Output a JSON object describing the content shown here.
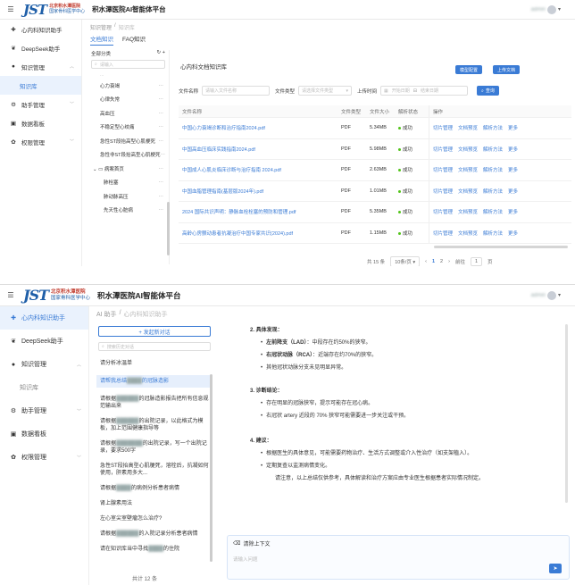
{
  "app": {
    "title": "积水潭医院AI智能体平台",
    "logo_mark": "JST",
    "logo_line1": "北京积水潭医院",
    "logo_line2": "国家骨科医学中心",
    "user": "admin"
  },
  "nav": {
    "cardio": "心内科知识助手",
    "deepseek": "DeepSeek助手",
    "knowledge": "知识管理",
    "knowledge_base": "知识库",
    "assistant_mgmt": "助手管理",
    "dashboard": "数据看板",
    "permissions": "权限管理"
  },
  "s1": {
    "breadcrumb": [
      "知识管理",
      "/",
      "知识库"
    ],
    "tabs": [
      "文档知识",
      "FAQ知识"
    ],
    "tree": {
      "header": "全部分类",
      "search_placeholder": "请输入",
      "items": [
        {
          "label": "心力衰竭",
          "type": "child"
        },
        {
          "label": "心律失常",
          "type": "child"
        },
        {
          "label": "高血压",
          "type": "child"
        },
        {
          "label": "不稳定型心绞痛",
          "type": "child"
        },
        {
          "label": "急性ST段抬高型心肌梗死",
          "type": "child"
        },
        {
          "label": "急性非ST段抬高型心肌梗死",
          "type": "child"
        },
        {
          "label": "病案首页",
          "type": "group"
        },
        {
          "label": "肺栓塞",
          "type": "child2"
        },
        {
          "label": "肺动脉高压",
          "type": "child2"
        },
        {
          "label": "先天性心脏病",
          "type": "child2"
        }
      ]
    },
    "main": {
      "title": "心内科文档知识库",
      "btn_config": "模型配置",
      "btn_upload": "上传文档",
      "filter_name_label": "文件名称",
      "filter_name_placeholder": "请输入文件名称",
      "filter_type_label": "文件类型",
      "filter_type_placeholder": "请选择文件类型",
      "filter_time_label": "上传时间",
      "filter_start": "开始日期",
      "filter_end": "结束日期",
      "btn_search": "查询",
      "columns": [
        "文件名称",
        "文件类型",
        "文件大小",
        "解析状态",
        "操作"
      ],
      "rows": [
        {
          "name": "中国心力衰竭诊断和治疗指南2024.pdf",
          "type": "PDF",
          "size": "5.34MB",
          "status": "成功"
        },
        {
          "name": "中国高血压临床实践指南2024.pdf",
          "type": "PDF",
          "size": "5.98MB",
          "status": "成功"
        },
        {
          "name": "中国成人心肌炎临床诊断与治疗指南 2024.pdf",
          "type": "PDF",
          "size": "2.63MB",
          "status": "成功"
        },
        {
          "name": "中国血脂管理指南(基层版2024年).pdf",
          "type": "PDF",
          "size": "1.01MB",
          "status": "成功"
        },
        {
          "name": "2024 国际共识声明：静脉血栓栓塞的预防和管理.pdf",
          "type": "PDF",
          "size": "5.35MB",
          "status": "成功"
        },
        {
          "name": "高龄心房颤动患者抗凝治疗中国专家共识(2024).pdf",
          "type": "PDF",
          "size": "1.15MB",
          "status": "成功"
        }
      ],
      "actions": [
        "切片管理",
        "文档预览",
        "解析方法",
        "更多"
      ],
      "pager": {
        "total": "共 15 条",
        "size": "10条/页",
        "p1": "1",
        "p2": "2",
        "goto": "前往",
        "goto_val": "1",
        "unit": "页"
      }
    }
  },
  "s2": {
    "breadcrumb": [
      "AI 助手",
      "/",
      "心内科知识助手"
    ],
    "new_chat": "+ 发起新对话",
    "search_placeholder": "搜索历史对话",
    "conversations": [
      {
        "text": "请分析冰温单",
        "sel": false
      },
      {
        "text": "请帮我总结████的冠脉造影",
        "sel": true
      },
      {
        "text": "请根据██████的冠脉造影报告把所有信息规范输出来",
        "sel": false
      },
      {
        "text": "请根据██████的出院记录，以此格式为模板，加上范围健康指导等",
        "sel": false
      },
      {
        "text": "请根据███████的出院记录，写一个出院记录，要求500字",
        "sel": false
      },
      {
        "text": "急性ST段抬高型心肌梗死，溶栓后，抗凝如何使用，肝素用多大...",
        "sel": false
      },
      {
        "text": "请根据████的病例分析患者病情",
        "sel": false
      },
      {
        "text": "肾上腺素用法",
        "sel": false
      },
      {
        "text": "左心室尖室壁瘤怎么治疗?",
        "sel": false
      },
      {
        "text": "请根据██████的入院记录分析患者病情",
        "sel": false
      },
      {
        "text": "请在知识库当中寻找████的住院",
        "sel": false
      }
    ],
    "total": "共计 12 条",
    "answer": {
      "sec2": "2. 具体发现：",
      "f1_bold": "左前降支（LAD）",
      "f1": "：中段存在约50%的狭窄。",
      "f2_bold": "右冠状动脉（RCA）",
      "f2": "：近端存在约70%的狭窄。",
      "f3": "其他冠状动脉分支未见明显异常。",
      "sec3": "3. 诊断结论：",
      "d1": "存在明显的冠脉狭窄，提示可能存在冠心病。",
      "d2": "右冠状 artery 近段的 70% 狭窄可能需要进一步关注或干预。",
      "sec4": "4. 建议：",
      "r1": "根据医生的具体意见，可能需要药物治疗、生活方式调整或介入性治疗（如支架植入）。",
      "r2": "定期复查以监测病情变化。",
      "note": "请注意，以上总结仅供参考，具体解读和治疗方案应由专业医生根据患者实际情况制定。"
    },
    "clear_context": "清除上下文",
    "input_placeholder": "请输入问题",
    "send": "➤"
  }
}
